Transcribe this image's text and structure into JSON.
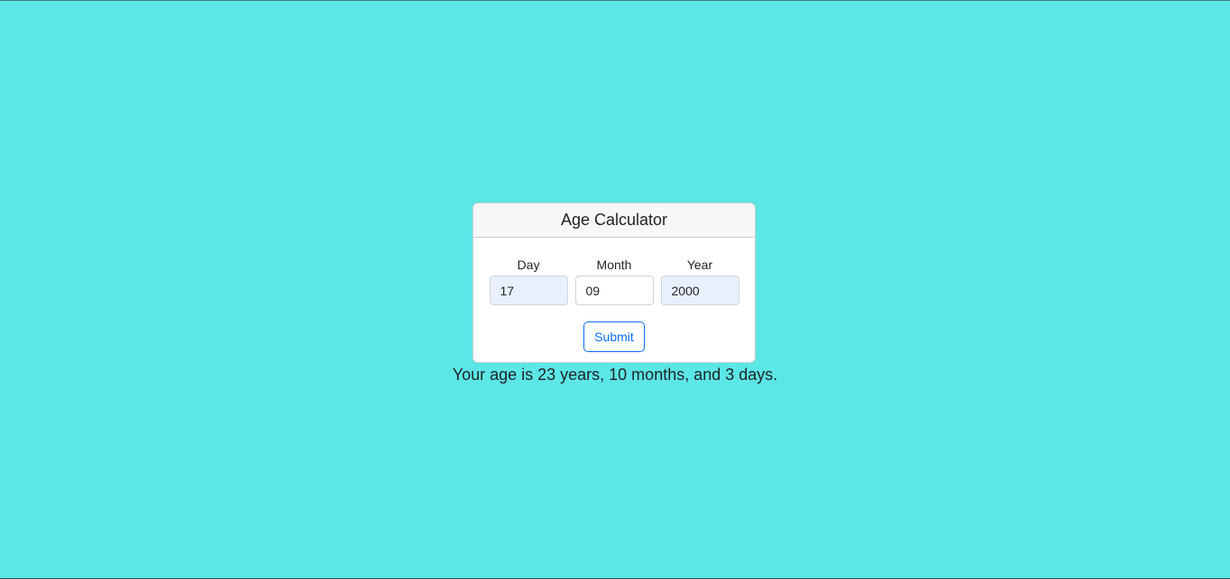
{
  "card": {
    "title": "Age Calculator"
  },
  "form": {
    "day_label": "Day",
    "day_value": "17",
    "month_label": "Month",
    "month_value": "09",
    "year_label": "Year",
    "year_value": "2000",
    "submit_label": "Submit"
  },
  "result": {
    "text": "Your age is 23 years, 10 months, and 3 days."
  },
  "colors": {
    "page_background": "#5ce6e6",
    "card_header_background": "#f7f7f7",
    "autofill_background": "#e8f0fe",
    "button_accent": "#0d6efd",
    "text": "#212529"
  }
}
